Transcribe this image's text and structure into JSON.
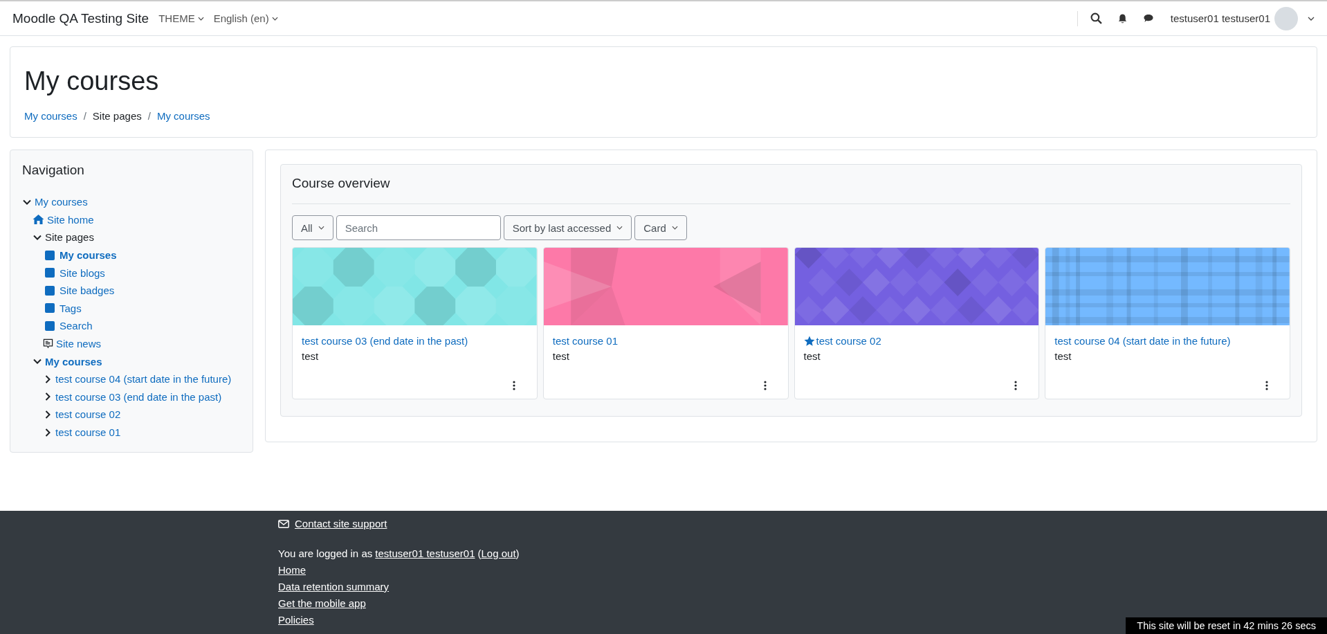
{
  "navbar": {
    "site_name": "Moodle QA Testing Site",
    "menus": [
      {
        "label": "THEME"
      },
      {
        "label": "English (en)"
      }
    ],
    "user_name": "testuser01 testuser01"
  },
  "page_header": {
    "title": "My courses",
    "separator": "/",
    "breadcrumbs": [
      {
        "label": "My courses",
        "link": true
      },
      {
        "label": "Site pages",
        "link": false
      },
      {
        "label": "My courses",
        "link": true
      }
    ]
  },
  "navigation": {
    "title": "Navigation",
    "items": [
      {
        "label": "My courses",
        "kind": "chevron",
        "expanded": true,
        "link": true,
        "current": false,
        "children": [
          {
            "label": "Site home",
            "kind": "home",
            "link": true,
            "current": false
          },
          {
            "label": "Site pages",
            "kind": "chevron",
            "expanded": true,
            "link": false,
            "current": false,
            "children": [
              {
                "label": "My courses",
                "kind": "square",
                "link": true,
                "current": true
              },
              {
                "label": "Site blogs",
                "kind": "square",
                "link": true,
                "current": false
              },
              {
                "label": "Site badges",
                "kind": "square",
                "link": true,
                "current": false
              },
              {
                "label": "Tags",
                "kind": "square",
                "link": true,
                "current": false
              },
              {
                "label": "Search",
                "kind": "square",
                "link": true,
                "current": false
              },
              {
                "label": "Site news",
                "kind": "news",
                "link": true,
                "current": false
              }
            ]
          },
          {
            "label": "My courses",
            "kind": "chevron",
            "expanded": true,
            "link": true,
            "current": true,
            "children": [
              {
                "label": "test course 04 (start date in the future)",
                "kind": "chevron",
                "expanded": false,
                "link": true,
                "current": false
              },
              {
                "label": "test course 03 (end date in the past)",
                "kind": "chevron",
                "expanded": false,
                "link": true,
                "current": false
              },
              {
                "label": "test course 02",
                "kind": "chevron",
                "expanded": false,
                "link": true,
                "current": false
              },
              {
                "label": "test course 01",
                "kind": "chevron",
                "expanded": false,
                "link": true,
                "current": false
              }
            ]
          }
        ]
      }
    ]
  },
  "course_overview": {
    "title": "Course overview",
    "filter": "All",
    "search": {
      "placeholder": "Search"
    },
    "sort": "Sort by last accessed",
    "view": "Card",
    "courses": [
      {
        "name": "test course 03 (end date in the past)",
        "category": "test",
        "starred": false,
        "kind": "octagons",
        "color": "#81e6e6"
      },
      {
        "name": "test course 01",
        "category": "test",
        "starred": false,
        "kind": "triangles",
        "color": "#fd79a8"
      },
      {
        "name": "test course 02",
        "category": "test",
        "starred": true,
        "kind": "diamonds",
        "color": "#7460e0"
      },
      {
        "name": "test course 04 (start date in the future)",
        "category": "test",
        "starred": false,
        "kind": "plaid",
        "color": "#74b9ff"
      }
    ]
  },
  "footer": {
    "contact": "Contact site support",
    "logged_in_prefix": "You are logged in as",
    "user_link": "testuser01 testuser01",
    "logout_open": "(",
    "logout": "Log out",
    "logout_close": ")",
    "links": [
      "Home",
      "Data retention summary",
      "Get the mobile app",
      "Policies"
    ]
  },
  "reset_notice": "This site will be reset in 42 mins 26 secs"
}
